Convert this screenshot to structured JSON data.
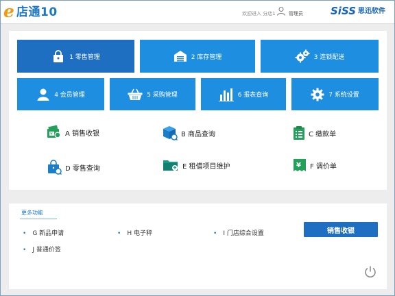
{
  "header": {
    "logo_mark": "e",
    "logo_name": "店通10",
    "welcome": "欢迎进入 分店1",
    "user_role": "管理员",
    "brand_siss": "SiSS",
    "brand_cn": "思迅软件"
  },
  "tiles_row1": [
    {
      "label": "1 零售管理",
      "icon": "lock-bag-icon"
    },
    {
      "label": "2 库存管理",
      "icon": "warehouse-icon"
    },
    {
      "label": "3 连锁配送",
      "icon": "gears-icon"
    }
  ],
  "tiles_row2": [
    {
      "label": "4 会员管理",
      "icon": "member-icon"
    },
    {
      "label": "5 采购管理",
      "icon": "basket-icon"
    },
    {
      "label": "6 报表查询",
      "icon": "bar-chart-icon"
    },
    {
      "label": "7 系统设置",
      "icon": "gear-icon"
    }
  ],
  "quick": [
    {
      "label": "A 销售收银",
      "icon": "wallet-icon",
      "color": "#23a05a"
    },
    {
      "label": "B 商品查询",
      "icon": "box-icon",
      "color": "#1a7fc8"
    },
    {
      "label": "C 缴款单",
      "icon": "clipboard-icon",
      "color": "#23a05a"
    },
    {
      "label": "D 零售查询",
      "icon": "bag-search-icon",
      "color": "#1a7fc8"
    },
    {
      "label": "E 租借项目维护",
      "icon": "folder-icon",
      "color": "#1a9a8a"
    },
    {
      "label": "F 调价单",
      "icon": "receipt-icon",
      "color": "#23a05a"
    }
  ],
  "more": {
    "title": "更多功能",
    "items": [
      "G 新品申请",
      "H 电子秤",
      "I 门店综合设置",
      "J 普通价签"
    ],
    "sell_button": "销售收银"
  },
  "colors": {
    "tile": "#1d8ee0",
    "tile_active": "#1e6ec2",
    "accent_orange": "#f09a16",
    "brand_blue": "#1563b5"
  }
}
